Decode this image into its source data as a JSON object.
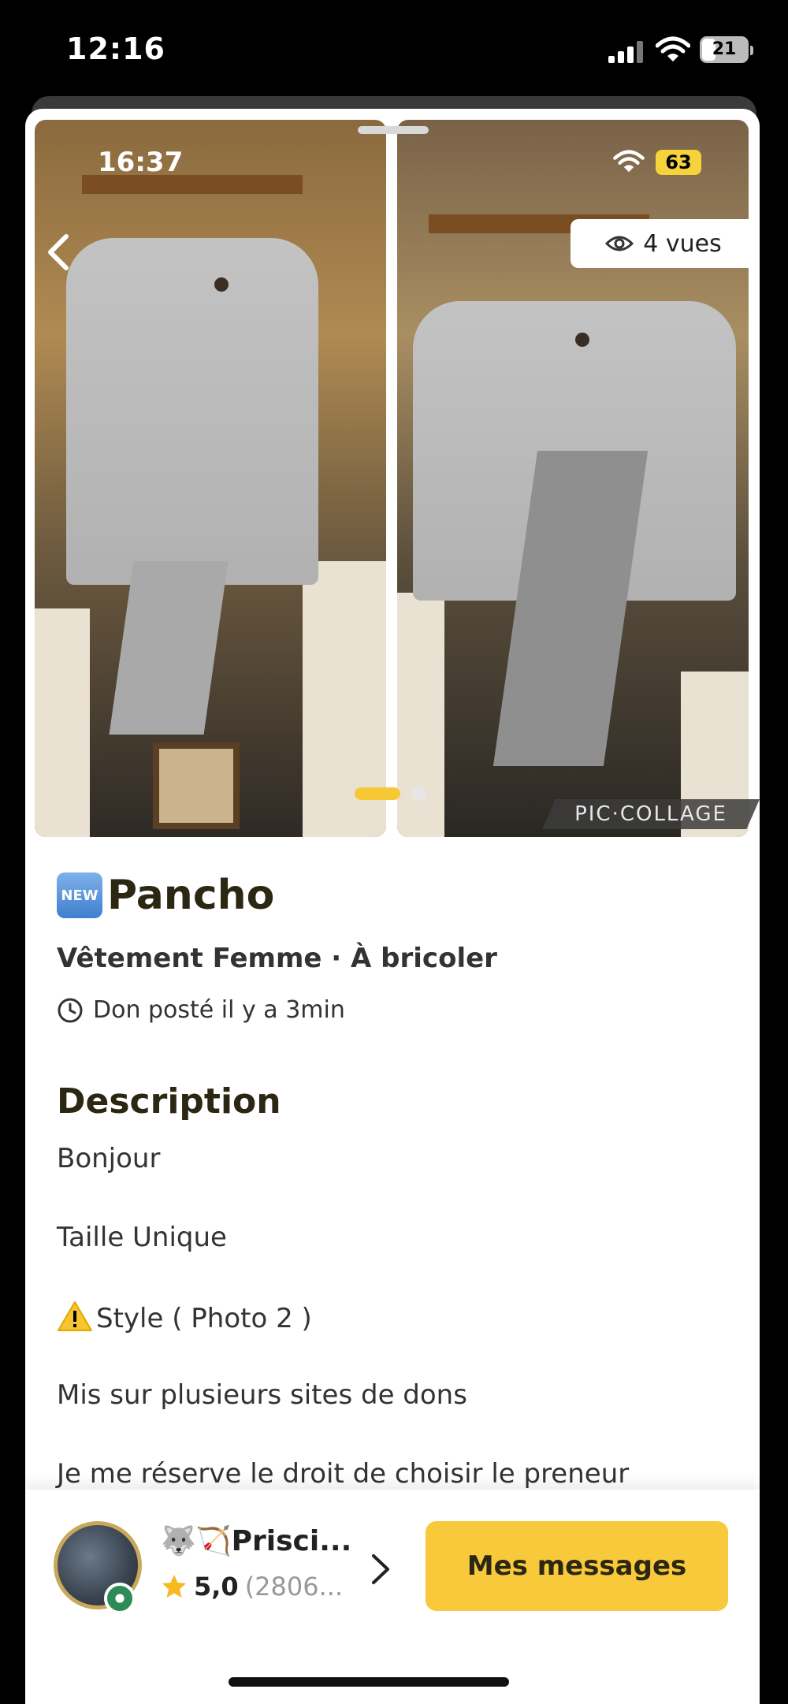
{
  "status_bar": {
    "time": "12:16",
    "battery": "21"
  },
  "photo_overlay": {
    "time": "16:37",
    "battery": "63",
    "views": "4 vues",
    "watermark": "PIC·COLLAGE"
  },
  "listing": {
    "badge": "NEW",
    "title": "Pancho",
    "category": "Vêtement Femme · À bricoler",
    "posted": "Don posté il y a 3min"
  },
  "description": {
    "heading": "Description",
    "lines": [
      "Bonjour",
      "Taille Unique",
      "Style ( Photo 2 )",
      "Mis sur plusieurs sites de dons",
      "Je me réserve le droit de choisir le preneur"
    ]
  },
  "user": {
    "name": "🐺🏹Prisci...",
    "rating": "5,0",
    "rating_count": "(2806..."
  },
  "actions": {
    "messages": "Mes messages"
  },
  "colors": {
    "accent": "#f8c93a",
    "title": "#2b2712"
  },
  "icons": [
    "back-chevron-icon",
    "eye-icon",
    "clock-icon",
    "warning-icon",
    "star-icon",
    "chevron-right-icon",
    "verified-icon"
  ]
}
